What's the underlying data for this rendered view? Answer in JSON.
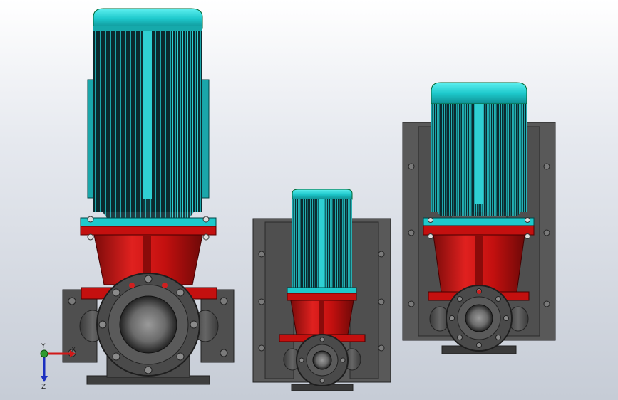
{
  "viewport": {
    "background_top": "#ffffff",
    "background_bottom": "#c6ccd6"
  },
  "colors": {
    "motor_cap": "#1ec9cc",
    "motor_fins_dark": "#0c2f33",
    "motor_fins_light": "#1aa6aa",
    "pump_body": "#c4100f",
    "pump_body_shade": "#7d0b0a",
    "frame_gray": "#565656",
    "flange_gray": "#4a4a4a"
  },
  "scene": {
    "objects": [
      {
        "name": "large-vertical-pump",
        "icon": "inline-pump-icon"
      },
      {
        "name": "small-vertical-pump-on-frame",
        "icon": "inline-pump-icon"
      },
      {
        "name": "medium-vertical-pump-on-frame",
        "icon": "inline-pump-icon"
      }
    ]
  },
  "triad": {
    "x_label": "X",
    "y_label": "Y",
    "z_label": "Z"
  }
}
